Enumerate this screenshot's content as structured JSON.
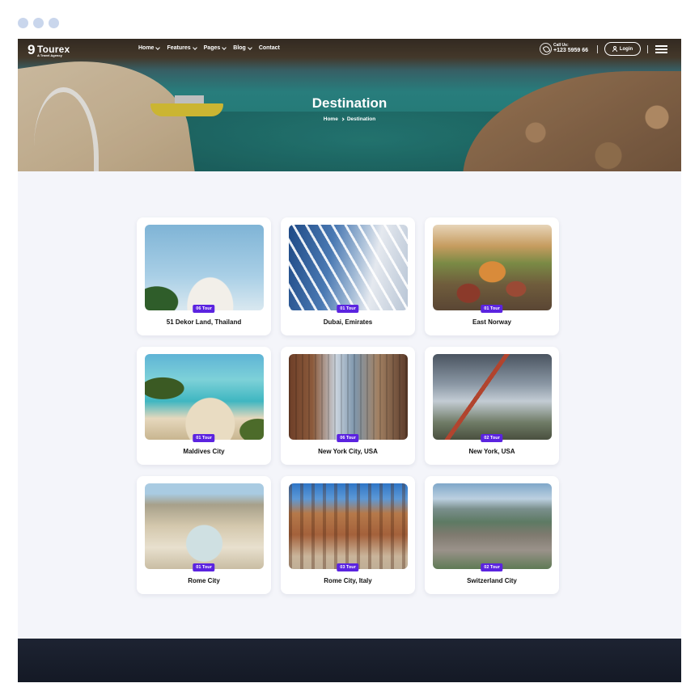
{
  "brand": {
    "logo_mark": "9",
    "name": "Tourex",
    "tagline": "A Travel Agency"
  },
  "nav": {
    "items": [
      {
        "label": "Home",
        "dropdown": true
      },
      {
        "label": "Features",
        "dropdown": true
      },
      {
        "label": "Pages",
        "dropdown": true
      },
      {
        "label": "Blog",
        "dropdown": true
      },
      {
        "label": "Contact",
        "dropdown": false
      }
    ],
    "call_label": "Call Us:",
    "call_number": "+123 5959 66",
    "login_label": "Login"
  },
  "hero": {
    "title": "Destination",
    "breadcrumb": [
      "Home",
      "Destination"
    ]
  },
  "destinations": [
    {
      "title": "51 Dekor Land, Thailand",
      "badge": "06 Tour",
      "image": "thailand"
    },
    {
      "title": "Dubai, Emirates",
      "badge": "01 Tour",
      "image": "dubai"
    },
    {
      "title": "East Norway",
      "badge": "01 Tour",
      "image": "norway"
    },
    {
      "title": "Maldives City",
      "badge": "01 Tour",
      "image": "maldives"
    },
    {
      "title": "New York City, USA",
      "badge": "06 Tour",
      "image": "nyc"
    },
    {
      "title": "New York, USA",
      "badge": "02 Tour",
      "image": "golden"
    },
    {
      "title": "Rome City",
      "badge": "01 Tour",
      "image": "rome"
    },
    {
      "title": "Rome City, Italy",
      "badge": "03 Tour",
      "image": "italy"
    },
    {
      "title": "Switzerland City",
      "badge": "02 Tour",
      "image": "swiss"
    }
  ],
  "colors": {
    "accent": "#5b23e0",
    "page_bg": "#f4f5fa",
    "footer": "#141925"
  },
  "icons": [
    "logo-icon",
    "chevron-down-icon",
    "phone-icon",
    "user-icon",
    "hamburger-menu-icon",
    "chevron-right-icon"
  ]
}
